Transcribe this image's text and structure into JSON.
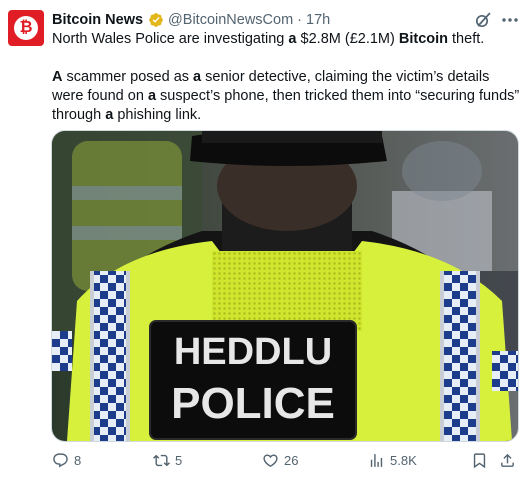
{
  "account": {
    "name": "Bitcoin News",
    "handle": "@BitcoinNewsCom",
    "separator": "·",
    "time": "17h",
    "avatar_symbol": "₿",
    "avatar_color": "#e01c24",
    "verified_badge": "gold-verified-badge-icon"
  },
  "tweet": {
    "line1": {
      "p1": "North Wales Police are investigating",
      "b1": "a",
      "p2": "$2.8M (£2.1M)",
      "b2": "Bitcoin",
      "p3": "theft."
    },
    "para2": {
      "b1": "A",
      "p1": "scammer posed as",
      "b2": "a",
      "p2": "senior detective, claiming the victim’s details were found on",
      "b3": "a",
      "p3": "suspect’s phone, then tricked them into “securing funds” through",
      "b4": "a",
      "p4": "phishing link."
    }
  },
  "media": {
    "patch_line1": "HEDDLU",
    "patch_line2": "POLICE"
  },
  "actions": {
    "replies": "8",
    "reposts": "5",
    "likes": "26",
    "views": "5.8K"
  },
  "colors": {
    "text": "#0f1419",
    "muted": "#536471",
    "hi_vis": "#d7f03c",
    "police_blue": "#1d3c8c"
  }
}
